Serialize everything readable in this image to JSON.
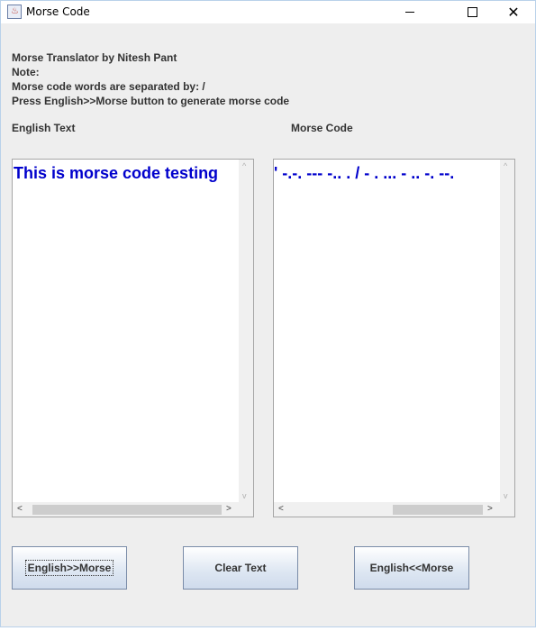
{
  "window": {
    "title": "Morse Code"
  },
  "info": {
    "line1": "Morse Translator by Nitesh Pant",
    "line2": "Note:",
    "line3": "Morse code words are separated by: /",
    "line4": "Press English>>Morse button to generate morse code"
  },
  "labels": {
    "english": "English Text",
    "morse": "Morse Code"
  },
  "english_text": {
    "value": "This is morse code testing"
  },
  "morse_text": {
    "value": "' -.-. --- -.. .  / - . ... - .. -. --."
  },
  "buttons": {
    "to_morse": "English>>Morse",
    "clear": "Clear Text",
    "to_english": "English<<Morse"
  },
  "icons": {
    "minimize": "minimize-icon",
    "maximize": "maximize-icon",
    "close": "close-icon",
    "app": "java-app-icon"
  }
}
